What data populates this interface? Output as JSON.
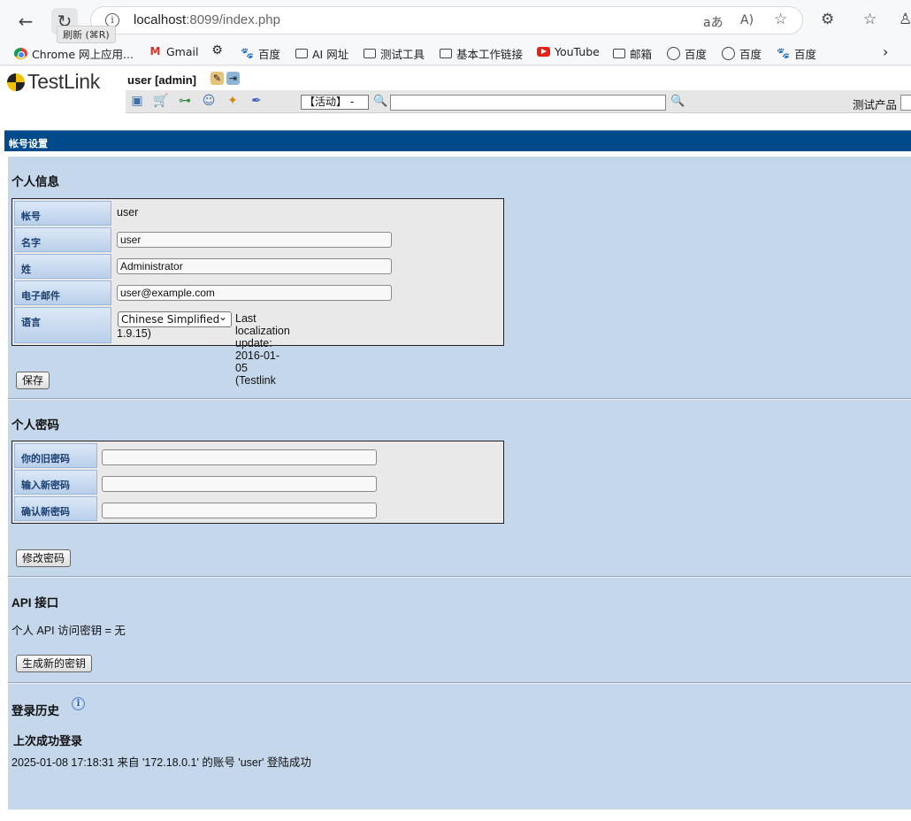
{
  "browser": {
    "tooltip": "刷新 (⌘R)",
    "url_host": "localhost",
    "url_rest": ":8099/index.php",
    "bookmarks": [
      {
        "label": "Chrome 网上应用...",
        "icon": "chrome-icon"
      },
      {
        "label": "Gmail",
        "icon": "gmail-icon"
      },
      {
        "label": "",
        "icon": "gear-icon"
      },
      {
        "label": "百度",
        "icon": "baidu-paw-icon"
      },
      {
        "label": "AI 网址",
        "icon": "folder-icon"
      },
      {
        "label": "测试工具",
        "icon": "folder-icon"
      },
      {
        "label": "基本工作链接",
        "icon": "folder-icon"
      },
      {
        "label": "YouTube",
        "icon": "youtube-icon"
      },
      {
        "label": "邮箱",
        "icon": "folder-icon"
      },
      {
        "label": "百度",
        "icon": "globe-icon"
      },
      {
        "label": "百度",
        "icon": "globe-icon"
      },
      {
        "label": "百度",
        "icon": "baidu-paw-icon"
      }
    ]
  },
  "header": {
    "logo_text": "TestLink",
    "user_line": "user [admin]",
    "status_select": "【活动】 -",
    "product_label": "测试产品"
  },
  "page": {
    "title": "帐号设置",
    "personal": {
      "heading": "个人信息",
      "account_label": "帐号",
      "account_value": "user",
      "first_name_label": "名字",
      "first_name_value": "user",
      "last_name_label": "姓",
      "last_name_value": "Administrator",
      "email_label": "电子邮件",
      "email_value": "user@example.com",
      "language_label": "语言",
      "language_value": "Chinese Simplified",
      "localization_note": "Last localization update: 2016-01-05 (Testlink",
      "localization_note_2": "1.9.15)",
      "save_button": "保存"
    },
    "password": {
      "heading": "个人密码",
      "old_label": "你的旧密码",
      "new_label": "输入新密码",
      "confirm_label": "确认新密码",
      "change_button": "修改密码"
    },
    "api": {
      "heading": "API 接口",
      "key_text": "个人 API 访问密钥 = 无",
      "generate_button": "生成新的密钥"
    },
    "history": {
      "heading": "登录历史",
      "last_login_heading": "上次成功登录",
      "last_login_text": "2025-01-08 17:18:31 来自 '172.18.0.1' 的账号 'user' 登陆成功"
    }
  }
}
